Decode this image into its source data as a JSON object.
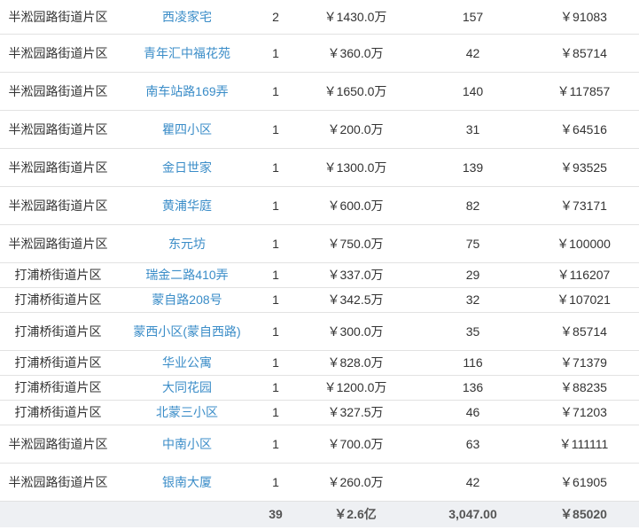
{
  "rows": [
    {
      "district": "半淞园路街道片区",
      "name": "西凌家宅",
      "count": "2",
      "total": "￥1430.0万",
      "area": "157",
      "unit_price": "￥91083"
    },
    {
      "district": "半淞园路街道片区",
      "name": "青年汇中福花苑",
      "count": "1",
      "total": "￥360.0万",
      "area": "42",
      "unit_price": "￥85714"
    },
    {
      "district": "半淞园路街道片区",
      "name": "南车站路169弄",
      "count": "1",
      "total": "￥1650.0万",
      "area": "140",
      "unit_price": "￥117857"
    },
    {
      "district": "半淞园路街道片区",
      "name": "瞿四小区",
      "count": "1",
      "total": "￥200.0万",
      "area": "31",
      "unit_price": "￥64516"
    },
    {
      "district": "半淞园路街道片区",
      "name": "金日世家",
      "count": "1",
      "total": "￥1300.0万",
      "area": "139",
      "unit_price": "￥93525"
    },
    {
      "district": "半淞园路街道片区",
      "name": "黄浦华庭",
      "count": "1",
      "total": "￥600.0万",
      "area": "82",
      "unit_price": "￥73171"
    },
    {
      "district": "半淞园路街道片区",
      "name": "东元坊",
      "count": "1",
      "total": "￥750.0万",
      "area": "75",
      "unit_price": "￥100000"
    },
    {
      "district": "打浦桥街道片区",
      "name": "瑞金二路410弄",
      "count": "1",
      "total": "￥337.0万",
      "area": "29",
      "unit_price": "￥116207"
    },
    {
      "district": "打浦桥街道片区",
      "name": "蒙自路208号",
      "count": "1",
      "total": "￥342.5万",
      "area": "32",
      "unit_price": "￥107021"
    },
    {
      "district": "打浦桥街道片区",
      "name": "蒙西小区(蒙自西路)",
      "count": "1",
      "total": "￥300.0万",
      "area": "35",
      "unit_price": "￥85714"
    },
    {
      "district": "打浦桥街道片区",
      "name": "华业公寓",
      "count": "1",
      "total": "￥828.0万",
      "area": "116",
      "unit_price": "￥71379"
    },
    {
      "district": "打浦桥街道片区",
      "name": "大同花园",
      "count": "1",
      "total": "￥1200.0万",
      "area": "136",
      "unit_price": "￥88235"
    },
    {
      "district": "打浦桥街道片区",
      "name": "北蒙三小区",
      "count": "1",
      "total": "￥327.5万",
      "area": "46",
      "unit_price": "￥71203"
    },
    {
      "district": "半淞园路街道片区",
      "name": "中南小区",
      "count": "1",
      "total": "￥700.0万",
      "area": "63",
      "unit_price": "￥111111"
    },
    {
      "district": "半淞园路街道片区",
      "name": "银南大厦",
      "count": "1",
      "total": "￥260.0万",
      "area": "42",
      "unit_price": "￥61905"
    }
  ],
  "totals": {
    "count": "39",
    "total": "￥2.6亿",
    "area": "3,047.00",
    "unit_price": "￥85020"
  },
  "colors": {
    "link": "#3b8dc8",
    "footer_bg": "#eef0f3",
    "border": "#e2e2e2"
  }
}
